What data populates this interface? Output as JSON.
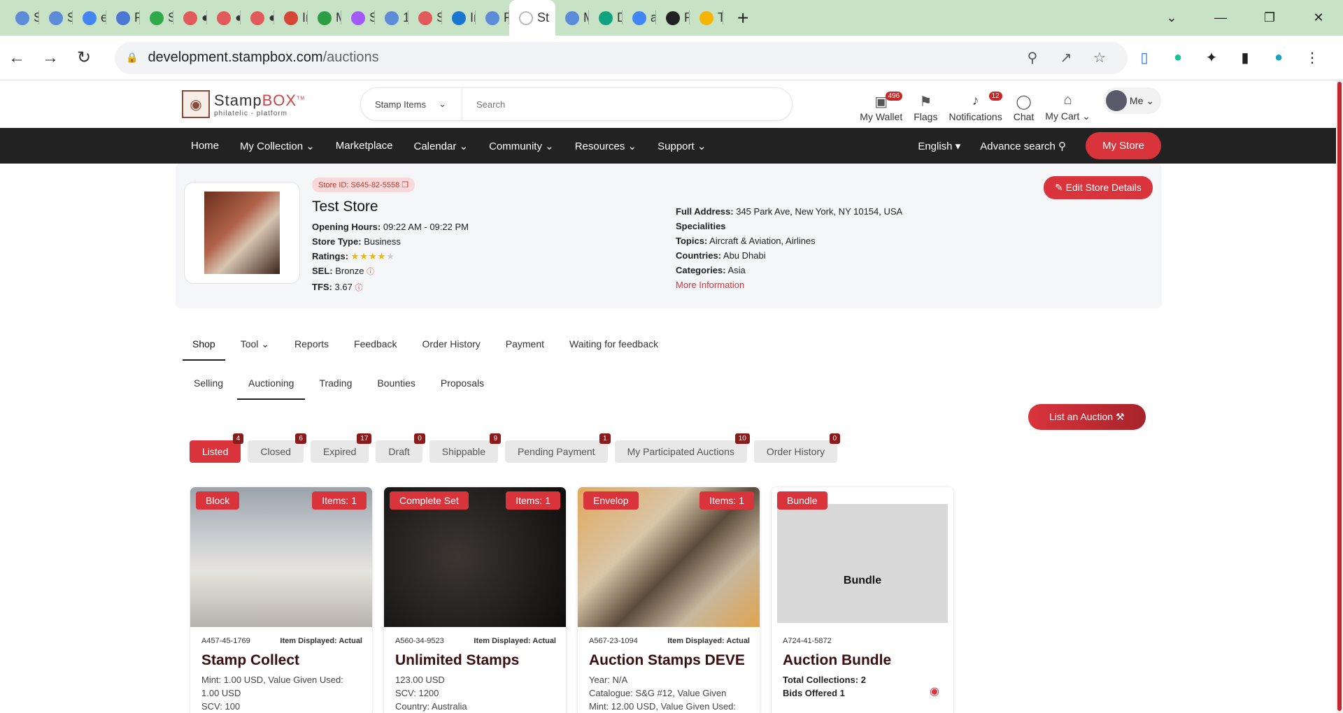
{
  "browser": {
    "tabs": [
      {
        "letter": "St",
        "color": "#5b8bd9"
      },
      {
        "letter": "St",
        "color": "#5b8bd9"
      },
      {
        "letter": "er",
        "color": "#4285f4"
      },
      {
        "letter": "Pr",
        "color": "#4a77d4"
      },
      {
        "letter": "St",
        "color": "#2eaa4a"
      },
      {
        "letter": "●",
        "color": "#e25a5a"
      },
      {
        "letter": "●",
        "color": "#e25a5a"
      },
      {
        "letter": "●",
        "color": "#e25a5a"
      },
      {
        "letter": "In",
        "color": "#d44638"
      },
      {
        "letter": "M",
        "color": "#2e9e44"
      },
      {
        "letter": "St",
        "color": "#a259ff"
      },
      {
        "letter": "1",
        "color": "#5b8bd9"
      },
      {
        "letter": "St",
        "color": "#e25a5a"
      },
      {
        "letter": "In",
        "color": "#1976d2"
      },
      {
        "letter": "Fl",
        "color": "#5b8bd9"
      },
      {
        "letter": "St",
        "color": "#eeeeee",
        "active": true
      },
      {
        "letter": "M",
        "color": "#5b8bd9"
      },
      {
        "letter": "D",
        "color": "#10a37f"
      },
      {
        "letter": "ai",
        "color": "#4285f4"
      },
      {
        "letter": "Fl",
        "color": "#222222"
      },
      {
        "letter": "Te",
        "color": "#f4b400"
      }
    ],
    "url_domain": "development.stampbox.com",
    "url_path": "/auctions"
  },
  "header": {
    "logo_main": "Stamp",
    "logo_accent": "BOX",
    "logo_tm": "TM",
    "logo_sub": "philatelic - platform",
    "search_category": "Stamp Items",
    "search_placeholder": "Search",
    "icons": [
      {
        "label": "My Wallet",
        "badge": "496",
        "glyph": "▣"
      },
      {
        "label": "Flags",
        "badge": "",
        "glyph": "⚑"
      },
      {
        "label": "Notifications",
        "badge": "12",
        "glyph": "♪"
      },
      {
        "label": "Chat",
        "badge": "",
        "glyph": "◯"
      },
      {
        "label": "My Cart",
        "badge": "",
        "glyph": "⌂"
      }
    ],
    "me_label": "Me"
  },
  "nav": {
    "items": [
      "Home",
      "My Collection",
      "Marketplace",
      "Calendar",
      "Community",
      "Resources",
      "Support"
    ],
    "language": "English",
    "advance_search": "Advance search",
    "my_store": "My Store"
  },
  "store": {
    "id": "Store ID: S645-82-5558",
    "name": "Test Store",
    "opening_label": "Opening Hours:",
    "opening_value": "09:22 AM - 09:22 PM",
    "type_label": "Store Type:",
    "type_value": "Business",
    "ratings_label": "Ratings:",
    "rating_stars": 4,
    "sel_label": "SEL:",
    "sel_value": "Bronze",
    "tfs_label": "TFS:",
    "tfs_value": "3.67",
    "address_label": "Full Address:",
    "address_value": "345 Park Ave, New York, NY 10154, USA",
    "specialities_label": "Specialities",
    "topics_label": "Topics:",
    "topics_value": "Aircraft & Aviation, Airlines",
    "countries_label": "Countries:",
    "countries_value": "Abu Dhabi",
    "categories_label": "Categories:",
    "categories_value": "Asia",
    "more_info": "More Information",
    "edit_button": "Edit Store Details"
  },
  "tabs_primary": [
    "Shop",
    "Tool",
    "Reports",
    "Feedback",
    "Order History",
    "Payment",
    "Waiting for feedback"
  ],
  "tabs_secondary": [
    "Selling",
    "Auctioning",
    "Trading",
    "Bounties",
    "Proposals"
  ],
  "list_auction_button": "List an Auction",
  "filters": [
    {
      "label": "Listed",
      "count": "4",
      "active": true
    },
    {
      "label": "Closed",
      "count": "6"
    },
    {
      "label": "Expired",
      "count": "17"
    },
    {
      "label": "Draft",
      "count": "0"
    },
    {
      "label": "Shippable",
      "count": "9"
    },
    {
      "label": "Pending Payment",
      "count": "1"
    },
    {
      "label": "My Participated Auctions",
      "count": "10"
    },
    {
      "label": "Order History",
      "count": "0"
    }
  ],
  "cards": [
    {
      "tag": "Block",
      "items": "Items: 1",
      "code": "A457-45-1769",
      "displayed": "Item Displayed: Actual",
      "title": "Stamp Collect",
      "lines": [
        "Mint: 1.00 USD, Value Given Used: 1.00 USD",
        "SCV: 100"
      ],
      "bg": "linear-gradient(180deg,#9aa3aa 0%,#c9cdd0 35%,#e6e4de 60%,#b7b3ab 100%)"
    },
    {
      "tag": "Complete Set",
      "items": "Items: 1",
      "code": "A560-34-9523",
      "displayed": "Item Displayed: Actual",
      "title": "Unlimited Stamps",
      "lines": [
        "123.00 USD",
        "SCV: 1200",
        "Country: Australia"
      ],
      "bg": "radial-gradient(circle at 40% 50%,#3b3632 0%,#1c1a18 70%,#0e0d0c 100%)"
    },
    {
      "tag": "Envelop",
      "items": "Items: 1",
      "code": "A567-23-1094",
      "displayed": "Item Displayed: Actual",
      "title": "Auction Stamps DEVE",
      "lines": [
        "Year: N/A",
        "Catalogue: S&G #12, Value Given",
        "Mint: 12.00 USD, Value Given Used:"
      ],
      "bg": "linear-gradient(135deg,#e2a85c 0%,#d8c6a8 35%,#5a4a3a 55%,#c8b89e 75%,#e0a34d 100%)"
    },
    {
      "tag": "Bundle",
      "items": "",
      "code": "A724-41-5872",
      "displayed": "",
      "title": "Auction Bundle",
      "bundle_text": "Bundle",
      "lines": [
        "Total Collections: 2",
        "Bids Offered 1"
      ],
      "bg": "#ffffff"
    }
  ]
}
